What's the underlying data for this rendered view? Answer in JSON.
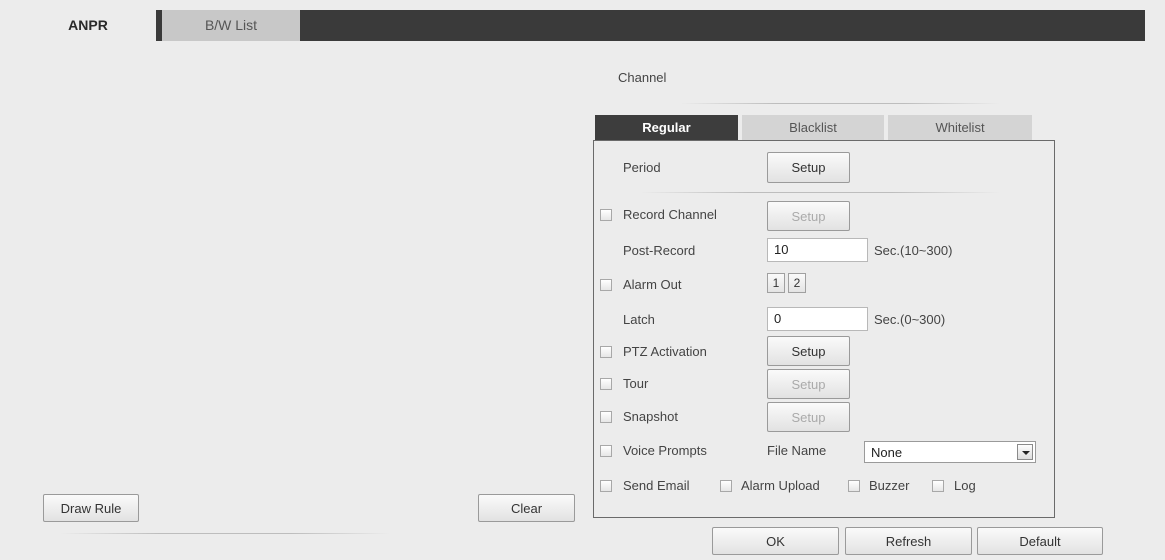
{
  "tabs": {
    "anpr": "ANPR",
    "bw_list": "B/W List"
  },
  "channel_label": "Channel",
  "subtabs": {
    "regular": "Regular",
    "blacklist": "Blacklist",
    "whitelist": "Whitelist"
  },
  "period": {
    "label": "Period",
    "button": "Setup"
  },
  "record_channel": {
    "label": "Record Channel",
    "button": "Setup",
    "checked": false
  },
  "post_record": {
    "label": "Post-Record",
    "value": "10",
    "hint": "Sec.(10~300)"
  },
  "alarm_out": {
    "label": "Alarm Out",
    "outputs": [
      "1",
      "2"
    ],
    "checked": false
  },
  "latch": {
    "label": "Latch",
    "value": "0",
    "hint": "Sec.(0~300)"
  },
  "ptz_activation": {
    "label": "PTZ Activation",
    "button": "Setup",
    "checked": false
  },
  "tour": {
    "label": "Tour",
    "button": "Setup",
    "checked": false
  },
  "snapshot": {
    "label": "Snapshot",
    "button": "Setup",
    "checked": false
  },
  "voice_prompts": {
    "label": "Voice Prompts",
    "file_name_label": "File Name",
    "file_name_value": "None",
    "checked": false
  },
  "send_email": {
    "label": "Send Email",
    "checked": false
  },
  "alarm_upload": {
    "label": "Alarm Upload",
    "checked": false
  },
  "buzzer": {
    "label": "Buzzer",
    "checked": false
  },
  "log": {
    "label": "Log",
    "checked": false
  },
  "buttons": {
    "draw_rule": "Draw Rule",
    "clear": "Clear",
    "ok": "OK",
    "refresh": "Refresh",
    "default": "Default"
  }
}
